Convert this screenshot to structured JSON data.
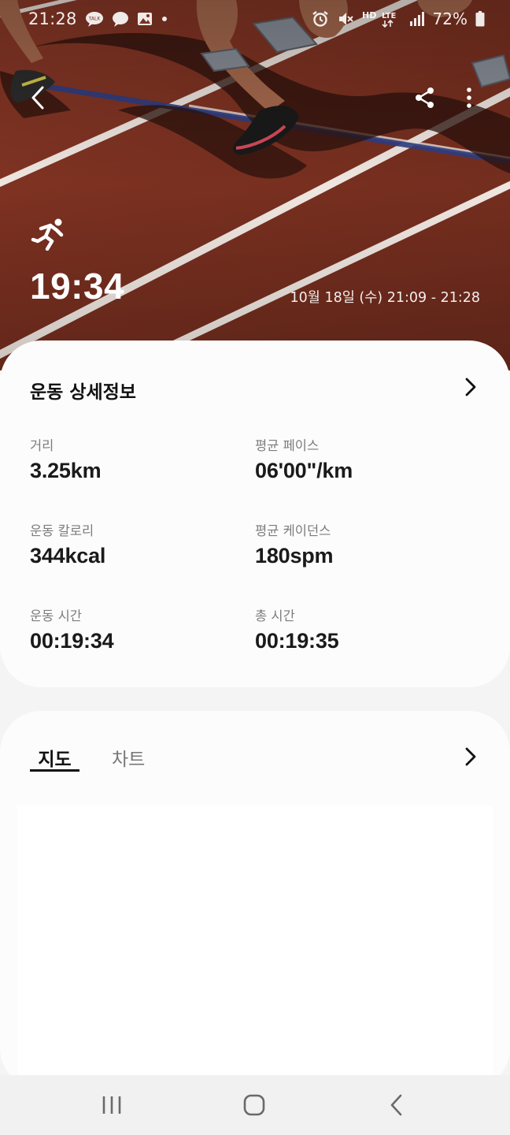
{
  "status_bar": {
    "time": "21:28",
    "talk_badge": "TALK",
    "network_label": "HD",
    "network_type": "LTE",
    "battery": "72%"
  },
  "header": {
    "activity_icon": "running-icon",
    "duration": "19:34",
    "datetime": "10월 18일 (수) 21:09 - 21:28"
  },
  "details": {
    "title": "운동 상세정보",
    "stats": [
      {
        "label": "거리",
        "value": "3.25km"
      },
      {
        "label": "평균 페이스",
        "value": "06'00\"/km"
      },
      {
        "label": "운동 칼로리",
        "value": "344kcal"
      },
      {
        "label": "평균 케이던스",
        "value": "180spm"
      },
      {
        "label": "운동 시간",
        "value": "00:19:34"
      },
      {
        "label": "총 시간",
        "value": "00:19:35"
      }
    ]
  },
  "map_section": {
    "tabs": [
      {
        "label": "지도",
        "selected": true
      },
      {
        "label": "차트",
        "selected": false
      }
    ]
  },
  "colors": {
    "track": "#7a3020",
    "card_bg": "#fcfcfc",
    "page_bg": "#f4f4f4"
  }
}
